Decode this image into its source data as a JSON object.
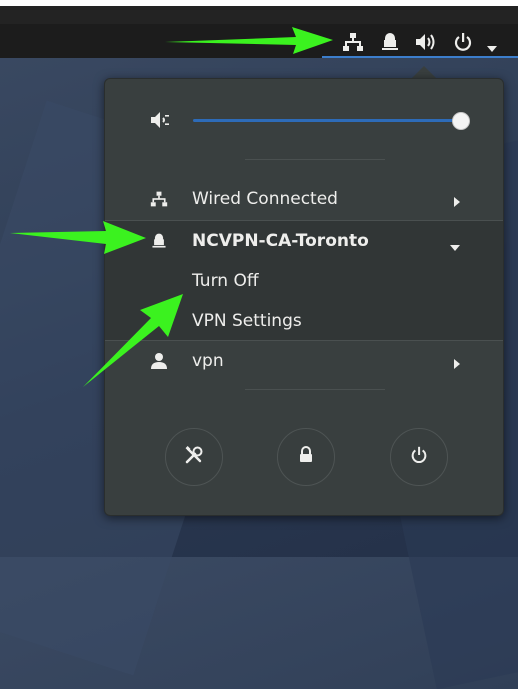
{
  "topbar": {
    "icons": [
      "network-wired-icon",
      "vpn-lock-icon",
      "volume-icon",
      "power-icon",
      "dropdown-arrow-icon"
    ]
  },
  "menu": {
    "volume": {
      "level": 1.0,
      "icon": "speaker-icon"
    },
    "wired": {
      "label": "Wired Connected",
      "icon": "network-wired-icon"
    },
    "vpn": {
      "label": "NCVPN-CA-Toronto",
      "icon": "vpn-lock-icon",
      "items": [
        "Turn Off",
        "VPN Settings"
      ]
    },
    "user": {
      "label": "vpn",
      "icon": "user-icon"
    },
    "actions": [
      "settings-icon",
      "lock-icon",
      "power-icon"
    ]
  },
  "colors": {
    "menu_bg": "#393f3f",
    "accent": "#2d6bb8",
    "arrow": "#3bf21f"
  }
}
